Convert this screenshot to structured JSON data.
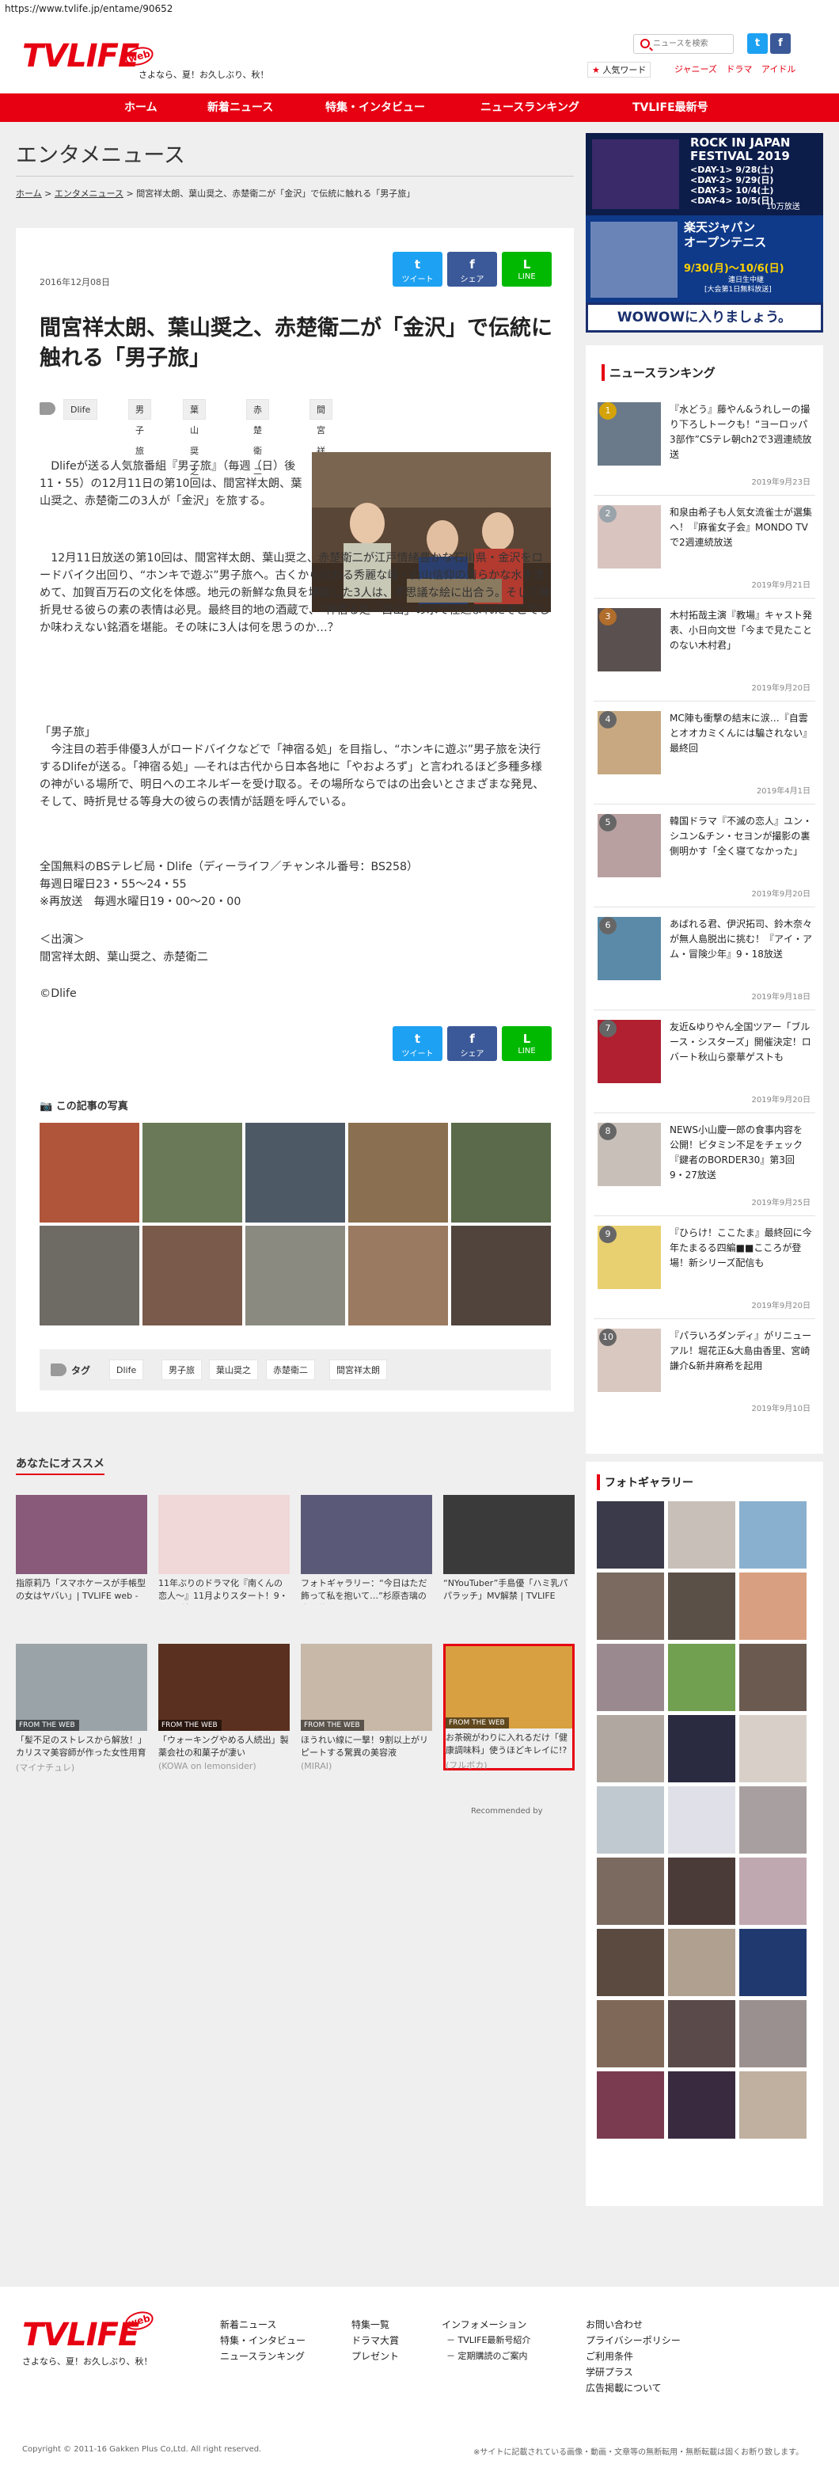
{
  "url": "https://www.tvlife.jp/entame/90652",
  "header": {
    "logo": "TVLIFE",
    "logo_web": "web",
    "tagline": "さよなら、夏！お久しぶり、秋！",
    "search_placeholder": "ニュースを検索",
    "twitter": "t",
    "facebook": "f",
    "popular_label": "人気ワード",
    "popular_words": [
      "ジャニーズ",
      "ドラマ",
      "アイドル"
    ]
  },
  "nav": [
    "ホーム",
    "新着ニュース",
    "特集・インタビュー",
    "ニュースランキング",
    "TVLIFE最新号"
  ],
  "page_heading": "エンタメニュース",
  "breadcrumb": {
    "home": "ホーム",
    "sep": ">",
    "section": "エンタメニュース",
    "current": "間宮祥太朗、葉山奨之、赤楚衛二が「金沢」で伝統に触れる「男子旅」"
  },
  "article": {
    "date": "2016年12月08日",
    "share": {
      "tweet": "ツイート",
      "share": "シェア",
      "line": "LINE",
      "tw_glyph": "t",
      "fb_glyph": "f",
      "line_glyph": "L"
    },
    "title": "間宮祥太朗、葉山奨之、赤楚衛二が「金沢」で伝統に触れる「男子旅」",
    "tags": [
      "Dlife",
      "男子旅",
      "葉山奨之",
      "赤楚衛二",
      "間宮祥太朗"
    ],
    "p1": "Dlifeが送る人気旅番組『男子旅』（毎週（日）後11・55）の12月11日の第10回は、間宮祥太朗、葉山奨之、赤楚衛二の3人が「金沢」を旅する。",
    "p2": "12月11日放送の第10回は、間宮祥太朗、葉山奨之、赤楚衛二が江戸情緒豊かな石川県・金沢をロードバイク出回り、“ホンキで遊ぶ”男子旅へ。古くから伝わる秀麗な峰・白山信仰の清らかな水を求めて、加賀百万石の文化を体感。地元の新鮮な魚貝を堪能した3人は、不思議な絵に出合う。そして時折見せる彼らの素の表情は必見。最終目的地の酒蔵で、「神宿る処―白山」の水で仕込まれたそこでしか味わえない銘酒を堪能。その味に3人は何を思うのか…？",
    "p3": "「男子旅」\n　今注目の若手俳優3人がロードバイクなどで「神宿る処」を目指し、“ホンキに遊ぶ”男子旅を決行するDlifeが送る。「神宿る処」―それは古代から日本各地に「やおよろず」と言われるほど多種多様の神がいる場所で、明日へのエネルギーを受け取る。その場所ならではの出会いとさまざまな発見、そして、時折見せる等身大の彼らの表情が話題を呼んでいる。",
    "p4": "全国無料のBSテレビ局・Dlife（ディーライフ／チャンネル番号：BS258）\n毎週日曜日23・55〜24・55\n※再放送　毎週水曜日19・00〜20・00",
    "p5": "＜出演＞\n間宮祥太朗、葉山奨之、赤楚衛二",
    "p6": "©Dlife",
    "photos_heading": "この記事の写真",
    "tag_label": "タグ"
  },
  "recommend": {
    "heading": "あなたにオススメ",
    "from_web": "FROM THE WEB",
    "items": [
      {
        "text": "指原莉乃「スマホケースが手帳型の女はヤバい」| TVLIFE web - テレビ",
        "src": ""
      },
      {
        "text": "11年ぶりのドラマ化『南くんの恋人〜』11月よりスタート！9・8には特別",
        "src": ""
      },
      {
        "text": "フォトギャラリー：“今日はただ飾って私を抱いて…”杉原杏璃の自伝的小",
        "src": ""
      },
      {
        "text": "“NYouTuber”手島優「ハミ乳パパラッチ」MV解禁 | TVLIFE web - テレ",
        "src": ""
      },
      {
        "text": "「髪不足のストレスから解放！」カリスマ美容師が作った女性用育毛剤",
        "src": "(マイナチュレ)"
      },
      {
        "text": "「ウォーキングやめる人続出」製薬会社の和菓子が凄い",
        "src": "(KOWA on lemonsider)"
      },
      {
        "text": "ほうれい線に一撃！9割以上がリピートする驚異の美容液",
        "src": "(MIRAI)"
      },
      {
        "text": "お茶碗がわりに入れるだけ「健康調味料」使うほどキレイに!?",
        "src": "(フルボカ)"
      }
    ],
    "recommended_by": "Recommended by"
  },
  "sidebar": {
    "banner": {
      "title1": "ROCK IN JAPAN",
      "title2": "FESTIVAL 2019",
      "day1": "<DAY-1> 9/28(土)",
      "day2": "<DAY-2> 9/29(日)",
      "day3": "<DAY-3> 10/4(土)",
      "day4": "<DAY-4> 10/5(日)",
      "note": "10万放送",
      "tennis1": "楽天ジャパン",
      "tennis2": "オープンテニス",
      "dates": "9/30(月)〜10/6(日)",
      "sub": "連日生中継",
      "sub2": "[大会第1日無料放送]",
      "cta": "WOWOWに入りましょう。"
    },
    "ranking_heading": "ニュースランキング",
    "ranking": [
      {
        "n": "1",
        "t": "『水どう』藤やん&うれしーの撮り下ろしトークも！“ヨーロッパ3部作”CSテレ朝ch2で3週連続放送",
        "d": "2019年9月23日"
      },
      {
        "n": "2",
        "t": "和泉由希子も人気女流雀士が選集へ！『麻雀女子会』MONDO TVで2週連続放送",
        "d": "2019年9月21日"
      },
      {
        "n": "3",
        "t": "木村拓哉主演『教場』キャスト発表、小日向文世「今まで見たことのない木村君」",
        "d": "2019年9月20日"
      },
      {
        "n": "4",
        "t": "MC陣も衝撃の結末に涙…『自雲とオオカミくんには騙されない』最終回",
        "d": "2019年4月1日"
      },
      {
        "n": "5",
        "t": "韓国ドラマ『不滅の恋人』ユン・シユン&チン・セヨンが撮影の裏側明かす「全く寝てなかった」",
        "d": "2019年9月20日"
      },
      {
        "n": "6",
        "t": "あばれる君、伊沢拓司、鈴木奈々が無人島脱出に挑む！『アイ・アム・冒険少年』9・18放送",
        "d": "2019年9月18日"
      },
      {
        "n": "7",
        "t": "友近&ゆりやん全国ツアー「ブルース・シスターズ」開催決定！ロバート秋山ら豪華ゲストも",
        "d": "2019年9月20日"
      },
      {
        "n": "8",
        "t": "NEWS小山慶一郎の食事内容を公開！ビタミン不足をチェック『鍵者のBORDER30』第3回 9・27放送",
        "d": "2019年9月25日"
      },
      {
        "n": "9",
        "t": "『ひらけ！ここたま』最終回に今年たまるる四編■■こころが登場！新シリーズ配信も",
        "d": "2019年9月20日"
      },
      {
        "n": "10",
        "t": "『パラいろダンディ』がリニューアル！堀花正&大島由香里、宮崎謙介&新井麻希を起用",
        "d": "2019年9月10日"
      }
    ],
    "photo_gallery": "フォトギャラリー"
  },
  "footer": {
    "logo": "TVLIFE",
    "logo_web": "web",
    "tagline": "さよなら、夏！お久しぶり、秋！",
    "col1": [
      "新着ニュース",
      "特集・インタビュー",
      "ニュースランキング"
    ],
    "col2": [
      "特集一覧",
      "ドラマ大賞",
      "プレゼント"
    ],
    "col3": [
      "インフォメーション",
      "－ TVLIFE最新号紹介",
      "－ 定期購読のご案内"
    ],
    "col4": [
      "お問い合わせ",
      "プライバシーポリシー",
      "ご利用条件",
      "学研プラス",
      "広告掲載について"
    ],
    "copyright": "Copyright © 2011-16 Gakken Plus Co,Ltd. All right reserved.",
    "notice": "※サイトに記載されている画像・動画・文章等の無断転用・無断転載は固くお断り致します。"
  }
}
